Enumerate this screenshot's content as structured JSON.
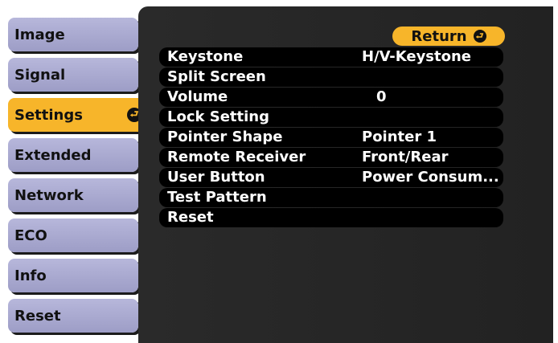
{
  "sidebar": {
    "tabs": [
      {
        "label": "Image"
      },
      {
        "label": "Signal"
      },
      {
        "label": "Settings",
        "active": true
      },
      {
        "label": "Extended"
      },
      {
        "label": "Network"
      },
      {
        "label": "ECO"
      },
      {
        "label": "Info"
      },
      {
        "label": "Reset"
      }
    ]
  },
  "panel": {
    "return_label": "Return",
    "items": [
      {
        "label": "Keystone",
        "value": "H/V-Keystone"
      },
      {
        "label": "Split Screen",
        "value": ""
      },
      {
        "label": "Volume",
        "value": "0"
      },
      {
        "label": "Lock Setting",
        "value": ""
      },
      {
        "label": "Pointer Shape",
        "value": "Pointer 1"
      },
      {
        "label": "Remote Receiver",
        "value": "Front/Rear"
      },
      {
        "label": "User Button",
        "value": "Power Consum..."
      },
      {
        "label": "Test Pattern",
        "value": ""
      },
      {
        "label": "Reset",
        "value": ""
      }
    ]
  },
  "colors": {
    "accent": "#f7b52a",
    "tab_inactive": "#a9a9d2",
    "panel_bg": "#262626",
    "row_bg": "#000000"
  },
  "icons": {
    "enter": "enter-icon"
  }
}
